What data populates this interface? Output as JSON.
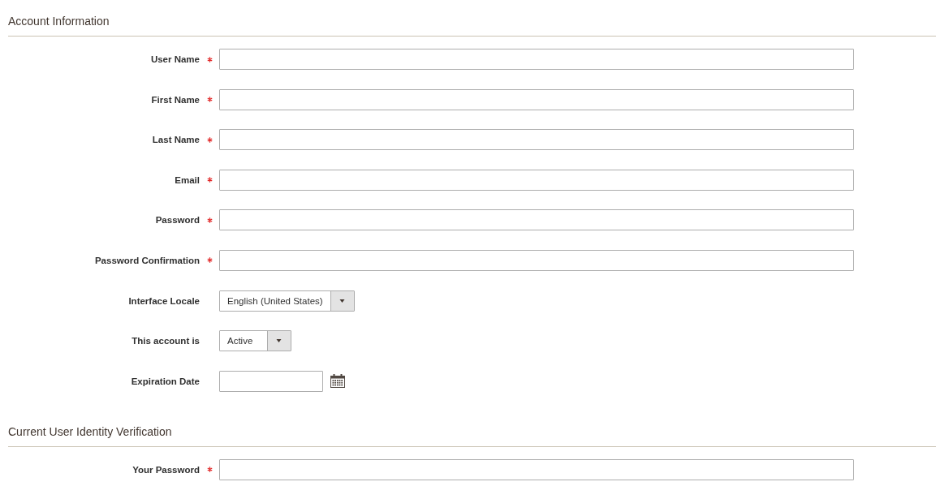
{
  "sections": [
    {
      "title": "Account Information",
      "fields": [
        {
          "kind": "text",
          "label": "User Name",
          "required": true
        },
        {
          "kind": "text",
          "label": "First Name",
          "required": true
        },
        {
          "kind": "text",
          "label": "Last Name",
          "required": true
        },
        {
          "kind": "text",
          "label": "Email",
          "required": true
        },
        {
          "kind": "text",
          "label": "Password",
          "required": true
        },
        {
          "kind": "text",
          "label": "Password Confirmation",
          "required": true
        },
        {
          "kind": "select",
          "label": "Interface Locale",
          "required": false,
          "value": "English (United States)"
        },
        {
          "kind": "select",
          "label": "This account is",
          "required": false,
          "value": "Active"
        },
        {
          "kind": "date",
          "label": "Expiration Date",
          "required": false
        }
      ]
    },
    {
      "title": "Current User Identity Verification",
      "fields": [
        {
          "kind": "text",
          "label": "Your Password",
          "required": true
        }
      ]
    }
  ]
}
